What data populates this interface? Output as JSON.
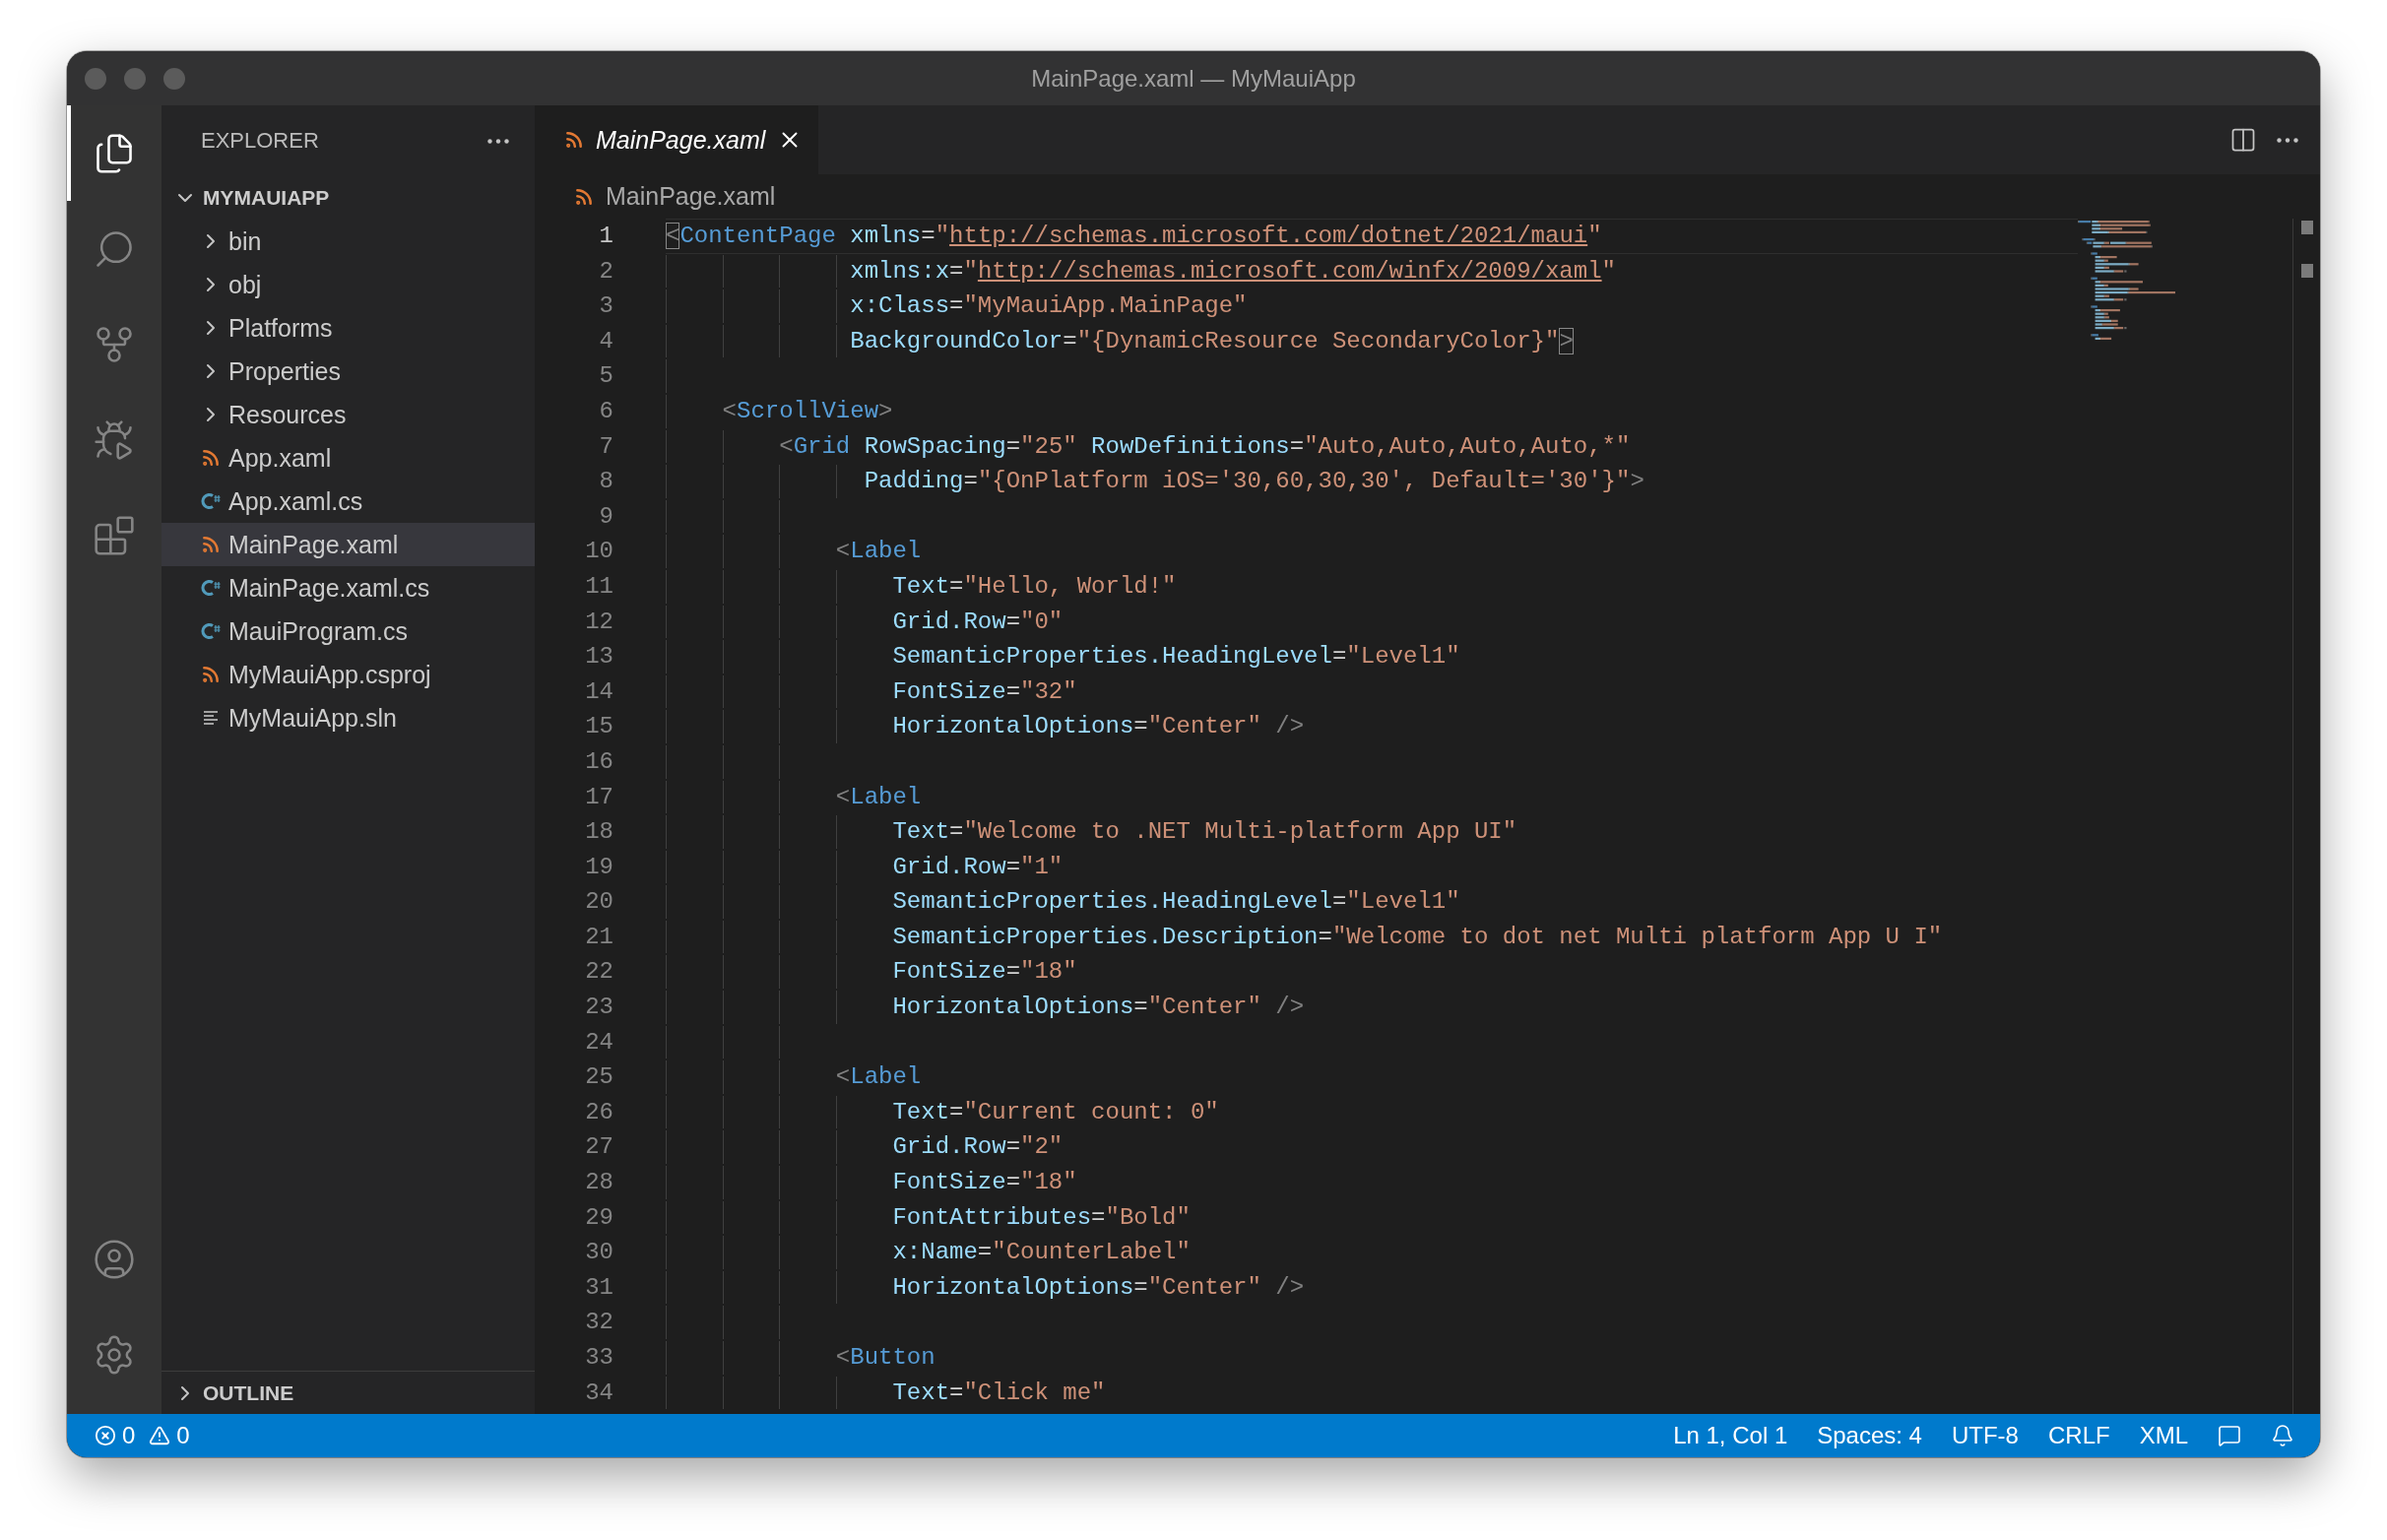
{
  "window": {
    "title": "MainPage.xaml — MyMauiApp"
  },
  "activity_bar": {
    "top": [
      {
        "kind": "files",
        "selected": true
      },
      {
        "kind": "search",
        "selected": false
      },
      {
        "kind": "source-control",
        "selected": false
      },
      {
        "kind": "run",
        "selected": false
      },
      {
        "kind": "extensions",
        "selected": false
      }
    ],
    "bottom": [
      {
        "kind": "account"
      },
      {
        "kind": "settings"
      }
    ]
  },
  "explorer": {
    "title": "EXPLORER",
    "root": {
      "label": "MYMAUIAPP",
      "expanded": true,
      "children": [
        {
          "kind": "folder",
          "label": "bin",
          "expanded": false,
          "selected": false
        },
        {
          "kind": "folder",
          "label": "obj",
          "expanded": false,
          "selected": false
        },
        {
          "kind": "folder",
          "label": "Platforms",
          "expanded": false,
          "selected": false
        },
        {
          "kind": "folder",
          "label": "Properties",
          "expanded": false,
          "selected": false
        },
        {
          "kind": "folder",
          "label": "Resources",
          "expanded": false,
          "selected": false
        },
        {
          "kind": "xml",
          "label": "App.xaml",
          "selected": false
        },
        {
          "kind": "csharp",
          "label": "App.xaml.cs",
          "selected": false
        },
        {
          "kind": "xml",
          "label": "MainPage.xaml",
          "selected": true
        },
        {
          "kind": "csharp",
          "label": "MainPage.xaml.cs",
          "selected": false
        },
        {
          "kind": "csharp",
          "label": "MauiProgram.cs",
          "selected": false
        },
        {
          "kind": "xml",
          "label": "MyMauiApp.csproj",
          "selected": false
        },
        {
          "kind": "solution",
          "label": "MyMauiApp.sln",
          "selected": false
        }
      ]
    },
    "outline": {
      "label": "OUTLINE",
      "expanded": false
    }
  },
  "tabs": [
    {
      "kind": "xml",
      "label": "MainPage.xaml",
      "selected": true,
      "preview": true
    }
  ],
  "breadcrumb": [
    {
      "kind": "xml",
      "label": "MainPage.xaml"
    }
  ],
  "editor": {
    "lines": [
      {
        "n": "1",
        "current": true,
        "tokens": [
          {
            "kind": "bracket",
            "text": "<"
          },
          {
            "kind": "tag",
            "text": "ContentPage"
          },
          {
            "kind": "attr",
            "text": " xmlns"
          },
          {
            "kind": "op",
            "text": "="
          },
          {
            "kind": "str",
            "text": "\""
          },
          {
            "kind": "link",
            "text": "http://schemas.microsoft.com/dotnet/2021/maui"
          },
          {
            "kind": "str",
            "text": "\""
          }
        ]
      },
      {
        "n": "2",
        "current": false,
        "tokens": [
          {
            "kind": "attr",
            "text": "             xmlns:x"
          },
          {
            "kind": "op",
            "text": "="
          },
          {
            "kind": "str",
            "text": "\""
          },
          {
            "kind": "link",
            "text": "http://schemas.microsoft.com/winfx/2009/xaml"
          },
          {
            "kind": "str",
            "text": "\""
          }
        ]
      },
      {
        "n": "3",
        "current": false,
        "tokens": [
          {
            "kind": "attr",
            "text": "             x:Class"
          },
          {
            "kind": "op",
            "text": "="
          },
          {
            "kind": "str",
            "text": "\"MyMauiApp.MainPage\""
          }
        ]
      },
      {
        "n": "4",
        "current": false,
        "tokens": [
          {
            "kind": "attr",
            "text": "             BackgroundColor"
          },
          {
            "kind": "op",
            "text": "="
          },
          {
            "kind": "str",
            "text": "\"{DynamicResource SecondaryColor}\""
          },
          {
            "kind": "bracket",
            "text": ">"
          }
        ]
      },
      {
        "n": "5",
        "current": false
      },
      {
        "n": "6",
        "current": false,
        "tokens": [
          {
            "kind": "punct",
            "text": "    <"
          },
          {
            "kind": "tag",
            "text": "ScrollView"
          },
          {
            "kind": "punct",
            "text": ">"
          }
        ]
      },
      {
        "n": "7",
        "current": false,
        "tokens": [
          {
            "kind": "punct",
            "text": "        <"
          },
          {
            "kind": "tag",
            "text": "Grid"
          },
          {
            "kind": "attr",
            "text": " RowSpacing"
          },
          {
            "kind": "op",
            "text": "="
          },
          {
            "kind": "str",
            "text": "\"25\""
          },
          {
            "kind": "attr",
            "text": " RowDefinitions"
          },
          {
            "kind": "op",
            "text": "="
          },
          {
            "kind": "str",
            "text": "\"Auto,Auto,Auto,Auto,*\""
          }
        ]
      },
      {
        "n": "8",
        "current": false,
        "tokens": [
          {
            "kind": "attr",
            "text": "              Padding"
          },
          {
            "kind": "op",
            "text": "="
          },
          {
            "kind": "str",
            "text": "\"{OnPlatform iOS='30,60,30,30', Default='30'}\""
          },
          {
            "kind": "punct",
            "text": ">"
          }
        ]
      },
      {
        "n": "9",
        "current": false
      },
      {
        "n": "10",
        "current": false,
        "tokens": [
          {
            "kind": "punct",
            "text": "            <"
          },
          {
            "kind": "tag",
            "text": "Label"
          }
        ]
      },
      {
        "n": "11",
        "current": false,
        "tokens": [
          {
            "kind": "attr",
            "text": "                Text"
          },
          {
            "kind": "op",
            "text": "="
          },
          {
            "kind": "str",
            "text": "\"Hello, World!\""
          }
        ]
      },
      {
        "n": "12",
        "current": false,
        "tokens": [
          {
            "kind": "attr",
            "text": "                Grid.Row"
          },
          {
            "kind": "op",
            "text": "="
          },
          {
            "kind": "str",
            "text": "\"0\""
          }
        ]
      },
      {
        "n": "13",
        "current": false,
        "tokens": [
          {
            "kind": "attr",
            "text": "                SemanticProperties.HeadingLevel"
          },
          {
            "kind": "op",
            "text": "="
          },
          {
            "kind": "str",
            "text": "\"Level1\""
          }
        ]
      },
      {
        "n": "14",
        "current": false,
        "tokens": [
          {
            "kind": "attr",
            "text": "                FontSize"
          },
          {
            "kind": "op",
            "text": "="
          },
          {
            "kind": "str",
            "text": "\"32\""
          }
        ]
      },
      {
        "n": "15",
        "current": false,
        "tokens": [
          {
            "kind": "attr",
            "text": "                HorizontalOptions"
          },
          {
            "kind": "op",
            "text": "="
          },
          {
            "kind": "str",
            "text": "\"Center\""
          },
          {
            "kind": "punct",
            "text": " />"
          }
        ]
      },
      {
        "n": "16",
        "current": false
      },
      {
        "n": "17",
        "current": false,
        "tokens": [
          {
            "kind": "punct",
            "text": "            <"
          },
          {
            "kind": "tag",
            "text": "Label"
          }
        ]
      },
      {
        "n": "18",
        "current": false,
        "tokens": [
          {
            "kind": "attr",
            "text": "                Text"
          },
          {
            "kind": "op",
            "text": "="
          },
          {
            "kind": "str",
            "text": "\"Welcome to .NET Multi-platform App UI\""
          }
        ]
      },
      {
        "n": "19",
        "current": false,
        "tokens": [
          {
            "kind": "attr",
            "text": "                Grid.Row"
          },
          {
            "kind": "op",
            "text": "="
          },
          {
            "kind": "str",
            "text": "\"1\""
          }
        ]
      },
      {
        "n": "20",
        "current": false,
        "tokens": [
          {
            "kind": "attr",
            "text": "                SemanticProperties.HeadingLevel"
          },
          {
            "kind": "op",
            "text": "="
          },
          {
            "kind": "str",
            "text": "\"Level1\""
          }
        ]
      },
      {
        "n": "21",
        "current": false,
        "tokens": [
          {
            "kind": "attr",
            "text": "                SemanticProperties.Description"
          },
          {
            "kind": "op",
            "text": "="
          },
          {
            "kind": "str",
            "text": "\"Welcome to dot net Multi platform App U I\""
          }
        ]
      },
      {
        "n": "22",
        "current": false,
        "tokens": [
          {
            "kind": "attr",
            "text": "                FontSize"
          },
          {
            "kind": "op",
            "text": "="
          },
          {
            "kind": "str",
            "text": "\"18\""
          }
        ]
      },
      {
        "n": "23",
        "current": false,
        "tokens": [
          {
            "kind": "attr",
            "text": "                HorizontalOptions"
          },
          {
            "kind": "op",
            "text": "="
          },
          {
            "kind": "str",
            "text": "\"Center\""
          },
          {
            "kind": "punct",
            "text": " />"
          }
        ]
      },
      {
        "n": "24",
        "current": false
      },
      {
        "n": "25",
        "current": false,
        "tokens": [
          {
            "kind": "punct",
            "text": "            <"
          },
          {
            "kind": "tag",
            "text": "Label"
          }
        ]
      },
      {
        "n": "26",
        "current": false,
        "tokens": [
          {
            "kind": "attr",
            "text": "                Text"
          },
          {
            "kind": "op",
            "text": "="
          },
          {
            "kind": "str",
            "text": "\"Current count: 0\""
          }
        ]
      },
      {
        "n": "27",
        "current": false,
        "tokens": [
          {
            "kind": "attr",
            "text": "                Grid.Row"
          },
          {
            "kind": "op",
            "text": "="
          },
          {
            "kind": "str",
            "text": "\"2\""
          }
        ]
      },
      {
        "n": "28",
        "current": false,
        "tokens": [
          {
            "kind": "attr",
            "text": "                FontSize"
          },
          {
            "kind": "op",
            "text": "="
          },
          {
            "kind": "str",
            "text": "\"18\""
          }
        ]
      },
      {
        "n": "29",
        "current": false,
        "tokens": [
          {
            "kind": "attr",
            "text": "                FontAttributes"
          },
          {
            "kind": "op",
            "text": "="
          },
          {
            "kind": "str",
            "text": "\"Bold\""
          }
        ]
      },
      {
        "n": "30",
        "current": false,
        "tokens": [
          {
            "kind": "attr",
            "text": "                x:Name"
          },
          {
            "kind": "op",
            "text": "="
          },
          {
            "kind": "str",
            "text": "\"CounterLabel\""
          }
        ]
      },
      {
        "n": "31",
        "current": false,
        "tokens": [
          {
            "kind": "attr",
            "text": "                HorizontalOptions"
          },
          {
            "kind": "op",
            "text": "="
          },
          {
            "kind": "str",
            "text": "\"Center\""
          },
          {
            "kind": "punct",
            "text": " />"
          }
        ]
      },
      {
        "n": "32",
        "current": false
      },
      {
        "n": "33",
        "current": false,
        "tokens": [
          {
            "kind": "punct",
            "text": "            <"
          },
          {
            "kind": "tag",
            "text": "Button"
          }
        ]
      },
      {
        "n": "34",
        "current": false,
        "tokens": [
          {
            "kind": "attr",
            "text": "                Text"
          },
          {
            "kind": "op",
            "text": "="
          },
          {
            "kind": "str",
            "text": "\"Click me\""
          }
        ]
      }
    ]
  },
  "status_bar": {
    "errors": "0",
    "warnings": "0",
    "items": [
      "Ln 1, Col 1",
      "Spaces: 4",
      "UTF-8",
      "CRLF",
      "XML"
    ]
  }
}
